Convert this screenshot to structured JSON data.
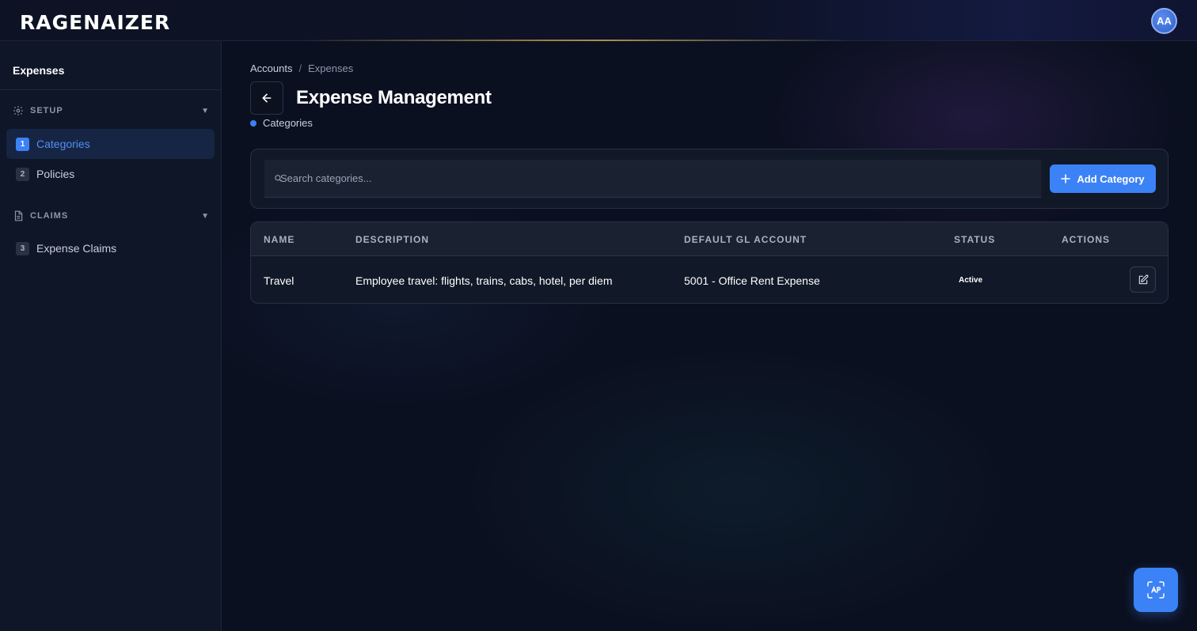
{
  "app": {
    "logo_text": "RAGENAIZER",
    "avatar_initials": "AA"
  },
  "sidebar": {
    "title": "Expenses",
    "sections": [
      {
        "label": "SETUP",
        "icon": "gear-icon",
        "caret": "▼"
      },
      {
        "label": "CLAIMS",
        "icon": "document-icon",
        "caret": "▼"
      }
    ],
    "items": [
      {
        "num": "1",
        "label": "Categories",
        "active": true
      },
      {
        "num": "2",
        "label": "Policies",
        "active": false
      },
      {
        "num": "3",
        "label": "Expense Claims",
        "active": false
      }
    ]
  },
  "breadcrumb": {
    "parent": "Accounts",
    "separator": "/",
    "current": "Expenses"
  },
  "header": {
    "title": "Expense Management",
    "subtab": "Categories"
  },
  "search": {
    "placeholder": "Search categories...",
    "value": ""
  },
  "toolbar": {
    "add_label": "Add Category"
  },
  "table": {
    "columns": [
      "NAME",
      "DESCRIPTION",
      "DEFAULT GL ACCOUNT",
      "STATUS",
      "ACTIONS"
    ],
    "rows": [
      {
        "name": "Travel",
        "description": "Employee travel: flights, trains, cabs, hotel, per diem",
        "gl_account": "5001 - Office Rent Expense",
        "status": "Active"
      }
    ]
  },
  "colors": {
    "accent": "#3b82f6",
    "background": "#0b1020",
    "sidebar": "#0f1628"
  }
}
